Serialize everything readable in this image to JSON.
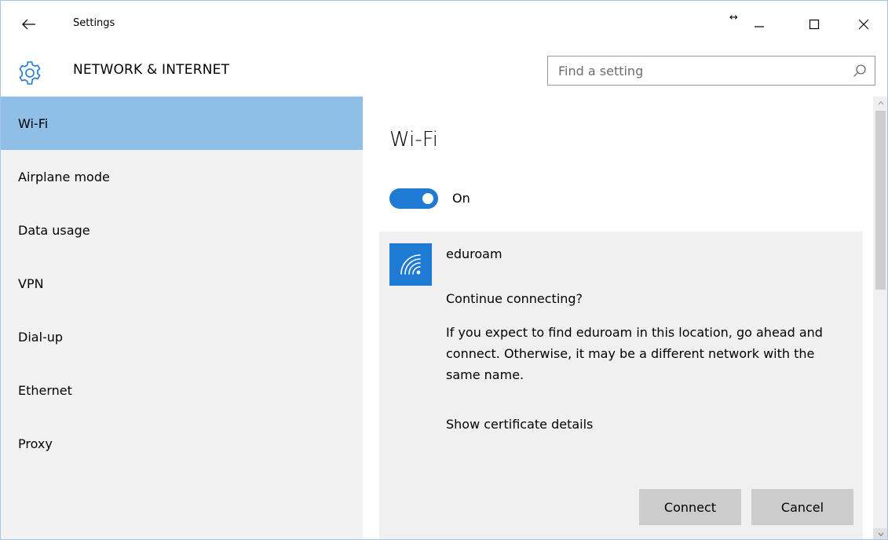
{
  "titlebar": {
    "app_title": "Settings",
    "resize_glyph": "↔"
  },
  "header": {
    "section_title": "NETWORK & INTERNET",
    "search_placeholder": "Find a setting"
  },
  "sidebar": {
    "items": [
      {
        "label": "Wi-Fi",
        "selected": true
      },
      {
        "label": "Airplane mode"
      },
      {
        "label": "Data usage"
      },
      {
        "label": "VPN"
      },
      {
        "label": "Dial-up"
      },
      {
        "label": "Ethernet"
      },
      {
        "label": "Proxy"
      }
    ]
  },
  "main": {
    "heading": "Wi-Fi",
    "toggle_label": "On",
    "toggle_on": true,
    "network": {
      "name": "eduroam",
      "prompt": "Continue connecting?",
      "description": "If you expect to find eduroam in this location, go ahead and connect. Otherwise, it may be a different network with the same name.",
      "cert_link": "Show certificate details",
      "connect_label": "Connect",
      "cancel_label": "Cancel"
    }
  },
  "colors": {
    "accent": "#1e7ad3",
    "selected_nav": "#8fbfe7",
    "sidebar_bg": "#f2f2f2",
    "card_bg": "#f0f0f0",
    "button_bg": "#cccccc"
  },
  "icons": {
    "back": "back-arrow-icon",
    "minimize": "minimize-icon",
    "maximize": "maximize-icon",
    "close": "close-icon",
    "settings": "gear-icon",
    "search": "search-icon",
    "wifi": "wifi-icon"
  }
}
